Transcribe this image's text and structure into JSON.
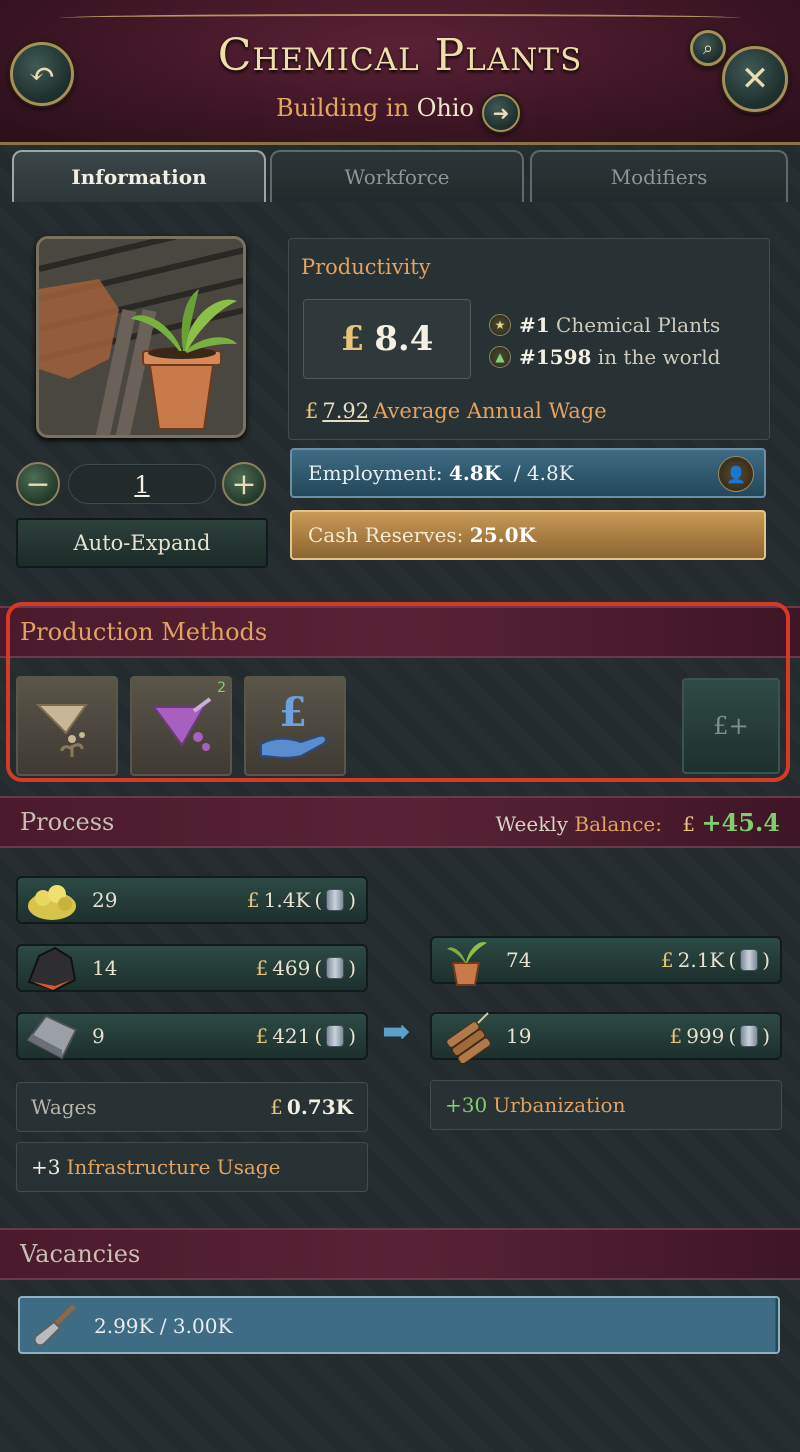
{
  "header": {
    "title": "Chemical Plants",
    "subtitle_prefix": "Building in",
    "subtitle_place": "Ohio"
  },
  "tabs": [
    {
      "label": "Information",
      "active": true
    },
    {
      "label": "Workforce",
      "active": false
    },
    {
      "label": "Modifiers",
      "active": false
    }
  ],
  "building": {
    "level": "1",
    "auto_expand_label": "Auto-Expand"
  },
  "productivity": {
    "label": "Productivity",
    "currency": "£",
    "value": "8.4",
    "rank_country_num": "#1",
    "rank_country_text": "Chemical Plants",
    "rank_world_num": "#1598",
    "rank_world_text": "in the world",
    "wage_value": "7.92",
    "wage_label": "Average Annual Wage"
  },
  "employment": {
    "label": "Employment:",
    "current": "4.8K",
    "max": "/ 4.8K"
  },
  "cash": {
    "label": "Cash Reserves:",
    "value": "25.0K"
  },
  "production_methods": {
    "title": "Production Methods",
    "items": [
      {
        "icon": "fertilizer-flask-icon"
      },
      {
        "icon": "purple-flask-icon",
        "badge": "2"
      },
      {
        "icon": "hand-pound-icon"
      }
    ],
    "add_label": "£+"
  },
  "process": {
    "title": "Process",
    "balance_label_1": "Weekly",
    "balance_label_2": "Balance:",
    "balance_value": "+45.4",
    "inputs": [
      {
        "icon": "sulfur-icon",
        "qty": "29",
        "price": "1.4K"
      },
      {
        "icon": "coal-icon",
        "qty": "14",
        "price": "469"
      },
      {
        "icon": "iron-icon",
        "qty": "9",
        "price": "421"
      }
    ],
    "outputs": [
      {
        "icon": "fertilizer-icon",
        "qty": "74",
        "price": "2.1K"
      },
      {
        "icon": "explosives-icon",
        "qty": "19",
        "price": "999"
      }
    ],
    "wages_label": "Wages",
    "wages_value": "0.73K",
    "infra_num": "+3",
    "infra_label": "Infrastructure Usage",
    "urban_num": "+30",
    "urban_label": "Urbanization",
    "price_paren_open": "(",
    "price_paren_close": ")"
  },
  "vacancies": {
    "title": "Vacancies",
    "value": "2.99K / 3.00K",
    "fill_fraction": 0.997
  },
  "colors": {
    "accent_gold": "#e2a260",
    "positive_green": "#7fcf6e",
    "highlight_red": "#d53a26",
    "header_maroon": "#5a2236"
  }
}
